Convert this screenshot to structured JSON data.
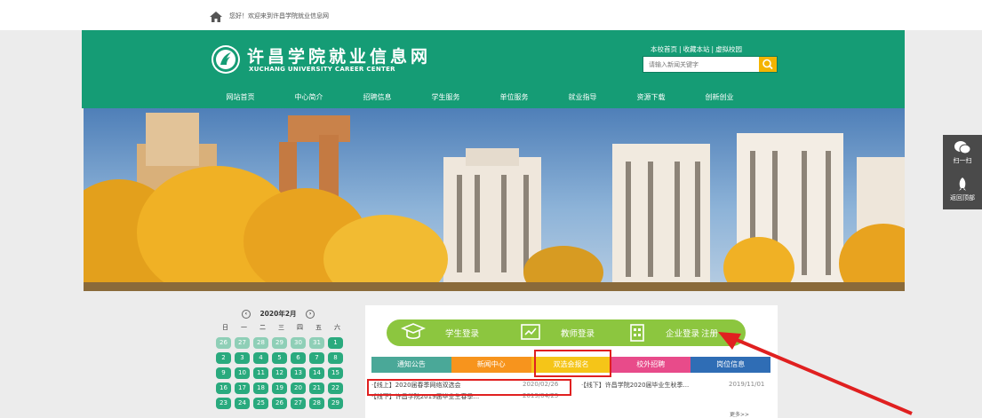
{
  "topbar": {
    "welcome": "您好！欢迎来到许昌学院就业信息网"
  },
  "header": {
    "title": "许昌学院就业信息网",
    "subtitle": "XUCHANG UNIVERSITY CAREER CENTER",
    "links": [
      "本校首页",
      "收藏本站",
      "虚拟校园"
    ],
    "search_placeholder": "请输入新闻关键字"
  },
  "nav": [
    "网站首页",
    "中心简介",
    "招聘信息",
    "学生服务",
    "单位服务",
    "就业指导",
    "资源下载",
    "创新创业"
  ],
  "side_buttons": {
    "wechat": "扫一扫",
    "top": "返回顶部"
  },
  "calendar": {
    "title": "2020年2月",
    "prev": "‹",
    "next": "›",
    "weekdays": [
      "日",
      "一",
      "二",
      "三",
      "四",
      "五",
      "六"
    ],
    "days": [
      {
        "d": "26",
        "other": true
      },
      {
        "d": "27",
        "other": true
      },
      {
        "d": "28",
        "other": true
      },
      {
        "d": "29",
        "other": true
      },
      {
        "d": "30",
        "other": true
      },
      {
        "d": "31",
        "other": true
      },
      {
        "d": "1"
      },
      {
        "d": "2"
      },
      {
        "d": "3"
      },
      {
        "d": "4"
      },
      {
        "d": "5"
      },
      {
        "d": "6"
      },
      {
        "d": "7"
      },
      {
        "d": "8"
      },
      {
        "d": "9"
      },
      {
        "d": "10"
      },
      {
        "d": "11"
      },
      {
        "d": "12"
      },
      {
        "d": "13"
      },
      {
        "d": "14"
      },
      {
        "d": "15"
      },
      {
        "d": "16"
      },
      {
        "d": "17"
      },
      {
        "d": "18"
      },
      {
        "d": "19"
      },
      {
        "d": "20"
      },
      {
        "d": "21"
      },
      {
        "d": "22"
      },
      {
        "d": "23"
      },
      {
        "d": "24"
      },
      {
        "d": "25"
      },
      {
        "d": "26"
      },
      {
        "d": "27"
      },
      {
        "d": "28"
      },
      {
        "d": "29"
      }
    ]
  },
  "login": {
    "student": "学生登录",
    "teacher": "教师登录",
    "company": "企业登录",
    "register": "注册"
  },
  "tabs": [
    {
      "label": "通知公告",
      "color": "#4aa898"
    },
    {
      "label": "新闻中心",
      "color": "#f7941d"
    },
    {
      "label": "双选会报名",
      "color": "#f5c518"
    },
    {
      "label": "校外招聘",
      "color": "#e84b8a"
    },
    {
      "label": "岗位信息",
      "color": "#2f6db5"
    }
  ],
  "news": [
    {
      "title": "·【线上】2020届春季网络双选会",
      "date": "2020/02/26"
    },
    {
      "title": "·【线下】许昌学院2020届毕业生秋季...",
      "date": "2019/11/01"
    },
    {
      "title": "·【线下】许昌学院2019届毕业生春季...",
      "date": "2019/04/25"
    }
  ],
  "more": "更多>>",
  "colors": {
    "green": "#159c75",
    "login_bar": "#8cc63f",
    "annotation": "#e02020"
  }
}
